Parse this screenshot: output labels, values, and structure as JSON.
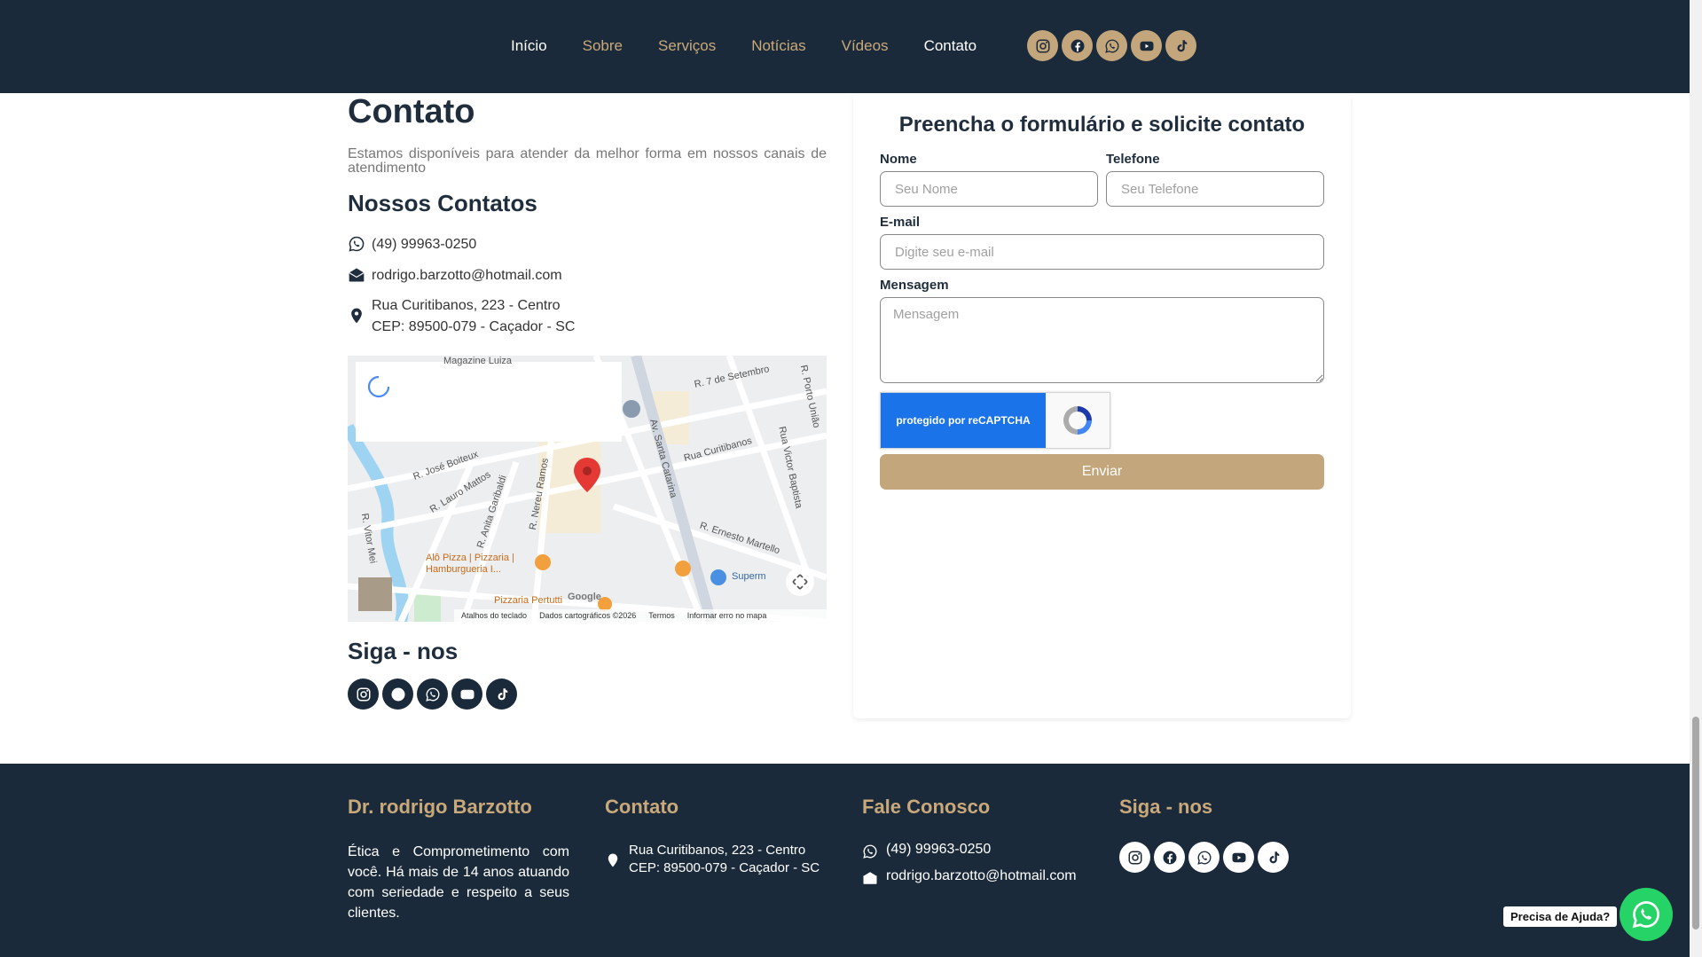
{
  "nav": {
    "items": [
      {
        "label": "Início",
        "active": true
      },
      {
        "label": "Sobre",
        "active": false
      },
      {
        "label": "Serviços",
        "active": false
      },
      {
        "label": "Notícias",
        "active": false
      },
      {
        "label": "Vídeos",
        "active": false
      },
      {
        "label": "Contato",
        "active": true
      }
    ],
    "social_icons": [
      "instagram-icon",
      "facebook-icon",
      "whatsapp-icon",
      "youtube-icon",
      "tiktok-icon"
    ]
  },
  "contact": {
    "title": "Contato",
    "intro": "Estamos disponíveis para atender da melhor forma em nossos canais de atendimento",
    "subtitle": "Nossos Contatos",
    "phone": "(49) 99963-0250",
    "email": "rodrigo.barzotto@hotmail.com",
    "address_line1": "Rua Curitibanos, 223 - Centro",
    "address_line2": "CEP: 89500-079 - Caçador - SC"
  },
  "map": {
    "labels": {
      "magazine": "Magazine Luiza",
      "sete_setembro": "R. 7 de Setembro",
      "porto_uniao": "R. Porto União",
      "jose_boiteux": "R. José Boiteux",
      "lauro_mattos": "R. Lauro Mattos",
      "anita": "R. Anita Garibaldi",
      "nereu": "R. Nereu Ramos",
      "santa_catarina": "Av. Santa Catarina",
      "curitibanos": "Rua Curitibanos",
      "victor_baptista": "Rua Victor Baptista",
      "ernesto": "R. Ernesto Martello",
      "vitor_meirelles": "R. Vitor Mei",
      "alo_pizza": "Alô Pizza | Pizzaria | Hamburgueria I...",
      "pizzaria": "Pizzaria Pertutti",
      "supermercado": "Superm",
      "google": "Google"
    },
    "footer": {
      "shortcuts": "Atalhos do teclado",
      "data": "Dados cartográficos ©2026",
      "terms": "Termos",
      "report": "Informar erro no mapa"
    }
  },
  "follow": {
    "title": "Siga - nos"
  },
  "form": {
    "title": "Preencha o formulário e solicite contato",
    "name_label": "Nome",
    "name_placeholder": "Seu Nome",
    "phone_label": "Telefone",
    "phone_placeholder": "Seu Telefone",
    "email_label": "E-mail",
    "email_placeholder": "Digite seu e-mail",
    "message_label": "Mensagem",
    "message_placeholder": "Mensagem",
    "recaptcha_text": "protegido por reCAPTCHA",
    "submit_label": "Enviar"
  },
  "footer": {
    "col1_title": "Dr. rodrigo Barzotto",
    "col1_text": "Ética e Comprometimento com você. Há mais de 14 anos atuando com seriedade e respeito a seus clientes.",
    "col2_title": "Contato",
    "col2_address_line1": "Rua Curitibanos, 223 - Centro",
    "col2_address_line2": "CEP: 89500-079 - Caçador - SC",
    "col3_title": "Fale Conosco",
    "col3_phone": "(49) 99963-0250",
    "col3_email": "rodrigo.barzotto@hotmail.com",
    "col4_title": "Siga - nos"
  },
  "help": {
    "label": "Precisa de Ajuda?"
  },
  "colors": {
    "navy": "#1b2a3a",
    "gold": "#c4a67c",
    "whatsapp": "#25d366",
    "recaptcha_blue": "#1a73e8"
  }
}
